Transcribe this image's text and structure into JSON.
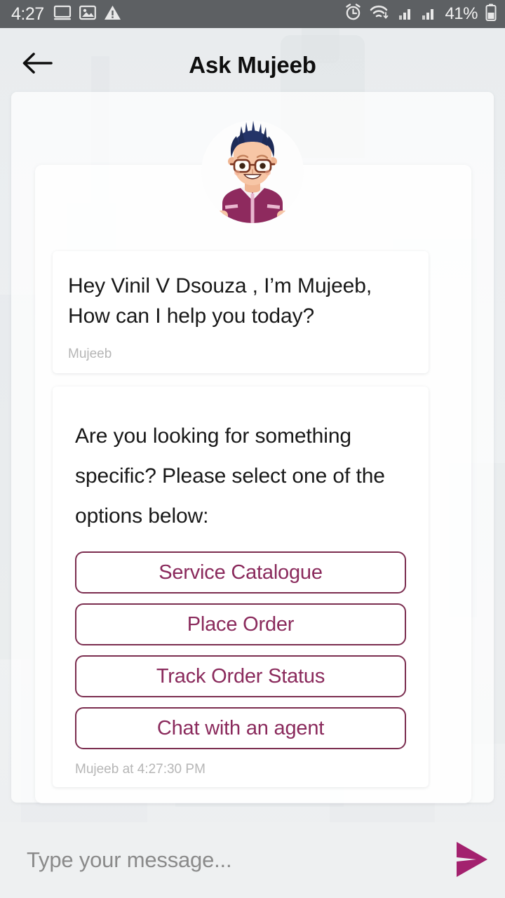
{
  "status_bar": {
    "time": "4:27",
    "battery_percent": "41%",
    "left_icons": [
      "screen-cast-icon",
      "image-icon",
      "warning-icon"
    ],
    "right_icons": [
      "alarm-icon",
      "wifi-icon",
      "signal-bars-icon-1",
      "signal-bars-icon-2",
      "battery-icon"
    ],
    "background_color": "#5d6063"
  },
  "header": {
    "title": "Ask Mujeeb",
    "back_icon": "back-arrow-icon"
  },
  "avatar": {
    "name": "mujeeb-avatar",
    "hair_color": "#243468",
    "skin_color": "#f7c6a6",
    "jacket_color": "#8e2a5e",
    "glasses_color": "#7a3520"
  },
  "messages": [
    {
      "id": "greeting",
      "text": "Hey Vinil V Dsouza , I’m Mujeeb, How can I help you today?",
      "meta": "Mujeeb"
    },
    {
      "id": "options",
      "text": "Are you looking for something specific? Please select one of the options below:",
      "meta": "Mujeeb at 4:27:30 PM"
    }
  ],
  "options": [
    {
      "label": "Service Catalogue",
      "name": "option-service-catalogue"
    },
    {
      "label": "Place Order",
      "name": "option-place-order"
    },
    {
      "label": "Track Order Status",
      "name": "option-track-order-status"
    },
    {
      "label": "Chat with an agent",
      "name": "option-chat-with-an-agent"
    }
  ],
  "composer": {
    "placeholder": "Type your message...",
    "value": "",
    "send_icon": "send-icon"
  },
  "theme": {
    "accent": "#8a2a5c",
    "accent_border": "#7b2d4f",
    "send_arrow": "#a3216e",
    "page_background": "#eceff1",
    "bubble_background": "#ffffff",
    "meta_text": "#b6b6b6"
  }
}
